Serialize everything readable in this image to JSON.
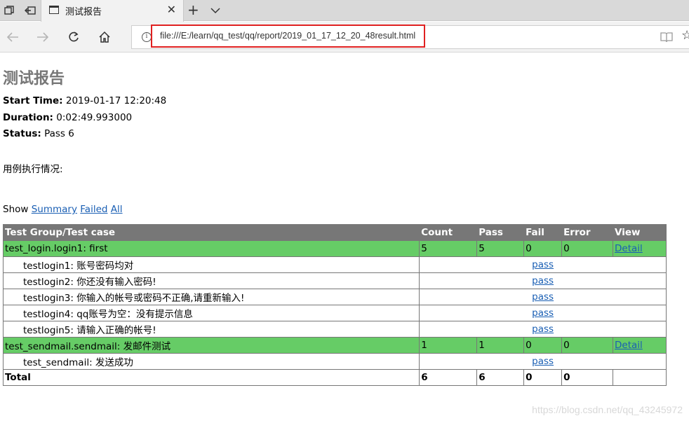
{
  "browser": {
    "tab_title": "测试报告",
    "url": "file:///E:/learn/qq_test/qq/report/2019_01_17_12_20_48result.html",
    "icons": [
      "tab-manager-icon",
      "set-aside-tabs-icon",
      "page-icon",
      "close-icon",
      "plus-icon",
      "chevron-down-icon",
      "back-icon",
      "forward-icon",
      "refresh-icon",
      "home-icon",
      "info-icon",
      "reading-view-icon",
      "favorite-star-icon"
    ],
    "highlight_color": "#e02020"
  },
  "report": {
    "heading": "测试报告",
    "start_time_label": "Start Time:",
    "start_time": "2019-01-17 12:20:48",
    "duration_label": "Duration:",
    "duration": "0:02:49.993000",
    "status_label": "Status:",
    "status": "Pass 6",
    "description": "用例执行情况:",
    "show_label": "Show",
    "show_summary": "Summary",
    "show_failed": "Failed",
    "show_all": "All"
  },
  "table": {
    "headers": [
      "Test Group/Test case",
      "Count",
      "Pass",
      "Fail",
      "Error",
      "View"
    ],
    "group1": {
      "name": "test_login.login1: first",
      "count": "5",
      "pass": "5",
      "fail": "0",
      "error": "0",
      "view": "Detail"
    },
    "group1_cases": [
      {
        "name": "testlogin1: 账号密码均对",
        "status": "pass"
      },
      {
        "name": "testlogin2: 你还没有输入密码!",
        "status": "pass"
      },
      {
        "name": "testlogin3: 你输入的帐号或密码不正确,请重新输入!",
        "status": "pass"
      },
      {
        "name": "testlogin4: qq账号为空：没有提示信息",
        "status": "pass"
      },
      {
        "name": "testlogin5: 请输入正确的帐号!",
        "status": "pass"
      }
    ],
    "group2": {
      "name": "test_sendmail.sendmail: 发邮件测试",
      "count": "1",
      "pass": "1",
      "fail": "0",
      "error": "0",
      "view": "Detail"
    },
    "group2_cases": [
      {
        "name": "test_sendmail: 发送成功",
        "status": "pass"
      }
    ],
    "total": {
      "label": "Total",
      "count": "6",
      "pass": "6",
      "fail": "0",
      "error": "0"
    },
    "colors": {
      "header_bg": "#777777",
      "pass_group_bg": "#66cc66",
      "link": "#1a5fb4"
    }
  },
  "watermark": "https://blog.csdn.net/qq_43245972"
}
